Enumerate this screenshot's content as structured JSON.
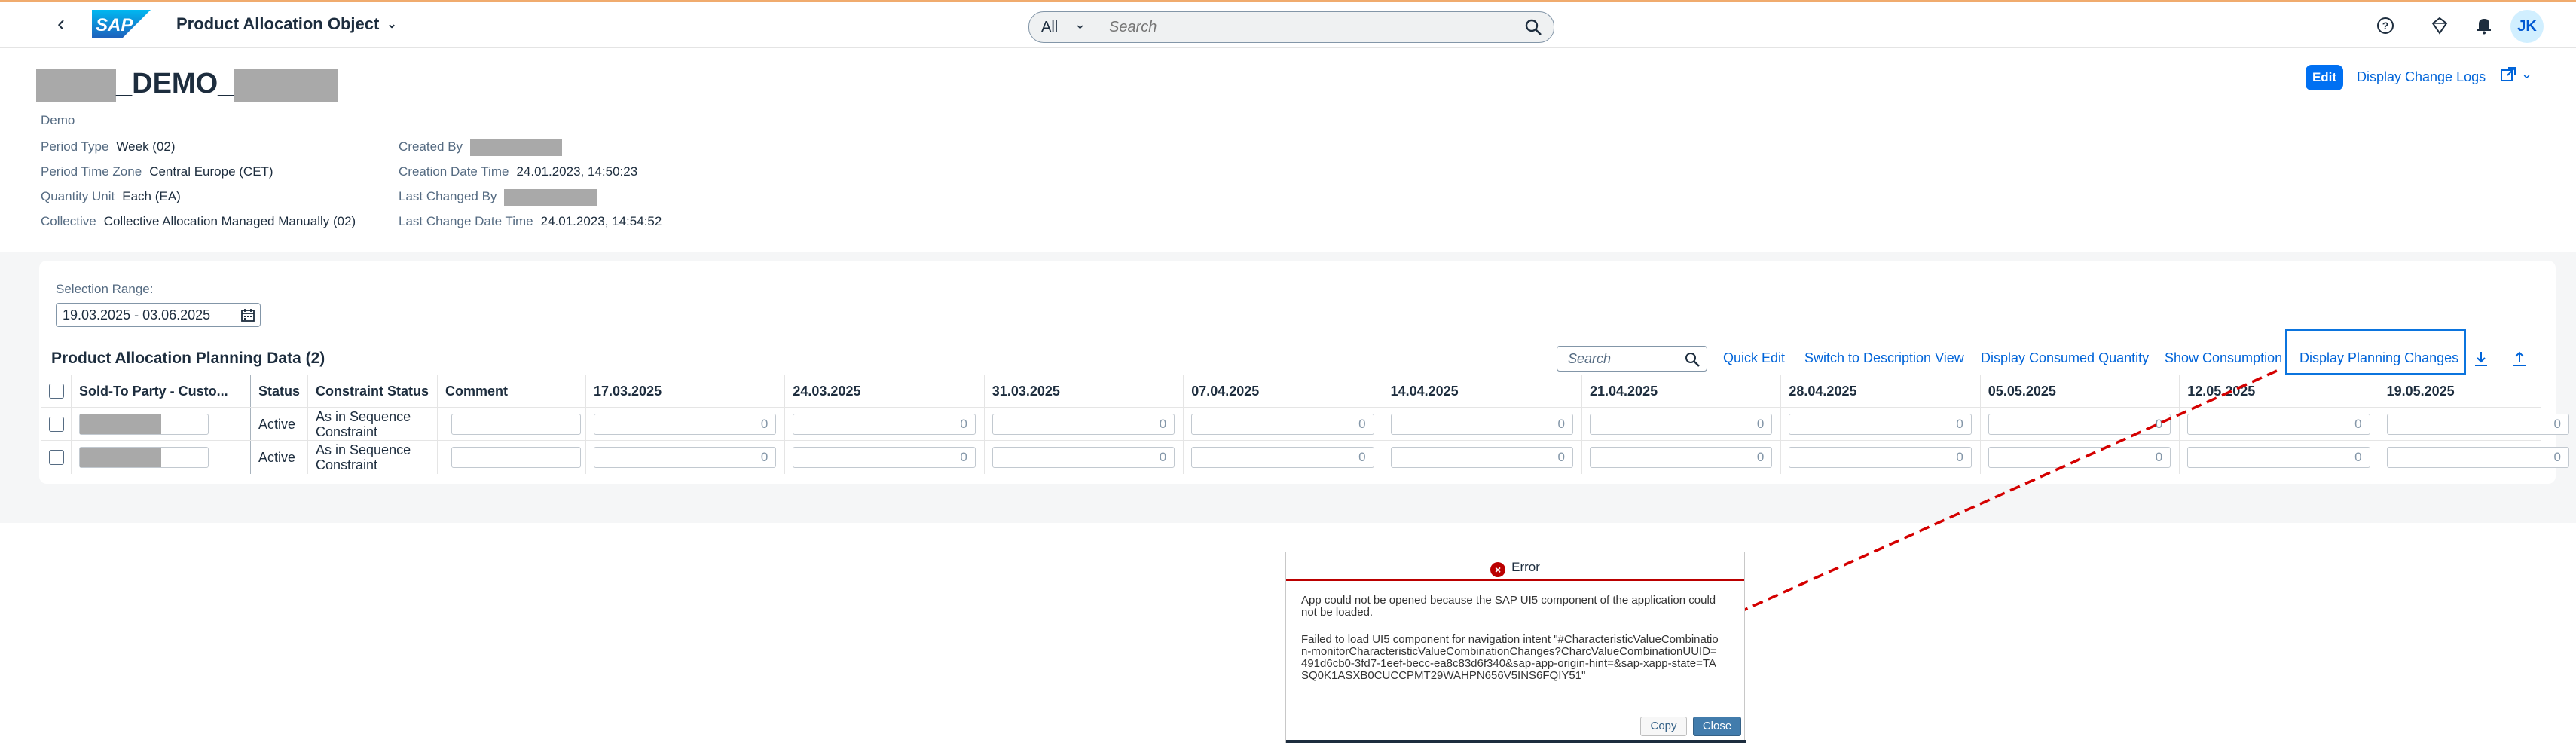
{
  "shell": {
    "app_title": "Product Allocation Object",
    "search_scope": "All",
    "search_placeholder": "Search",
    "avatar_initials": "JK"
  },
  "header": {
    "title_middle": "_DEMO_",
    "subtitle": "Demo",
    "left_attrs": [
      {
        "label": "Period Type",
        "value": "Week (02)"
      },
      {
        "label": "Period Time Zone",
        "value": "Central Europe (CET)"
      },
      {
        "label": "Quantity Unit",
        "value": "Each (EA)"
      },
      {
        "label": "Collective",
        "value": "Collective Allocation Managed Manually (02)"
      }
    ],
    "right_attrs": [
      {
        "label": "Created By",
        "value": ""
      },
      {
        "label": "Creation Date Time",
        "value": "24.01.2023, 14:50:23"
      },
      {
        "label": "Last Changed By",
        "value": ""
      },
      {
        "label": "Last Change Date Time",
        "value": "24.01.2023, 14:54:52"
      }
    ],
    "edit_label": "Edit",
    "change_logs_label": "Display Change Logs"
  },
  "selection": {
    "label": "Selection Range:",
    "value": "19.03.2025 - 03.06.2025"
  },
  "table": {
    "title": "Product Allocation Planning Data (2)",
    "search_placeholder": "Search",
    "toolbar": {
      "quick_edit": "Quick Edit",
      "switch_desc": "Switch to Description View",
      "consumed_qty": "Display Consumed Quantity",
      "show_consumption": "Show Consumption",
      "planning_changes": "Display Planning Changes"
    },
    "columns": {
      "sold_to": "Sold-To Party - Custo...",
      "status": "Status",
      "constraint": "Constraint Status",
      "comment": "Comment",
      "weeks": [
        "17.03.2025",
        "24.03.2025",
        "31.03.2025",
        "07.04.2025",
        "14.04.2025",
        "21.04.2025",
        "28.04.2025",
        "05.05.2025",
        "12.05.2025",
        "19.05.2025"
      ]
    },
    "rows": [
      {
        "status": "Active",
        "constraint_line1": "As in Sequence",
        "constraint_line2": "Constraint",
        "values": [
          "0",
          "0",
          "0",
          "0",
          "0",
          "0",
          "0",
          "0",
          "0",
          "0"
        ]
      },
      {
        "status": "Active",
        "constraint_line1": "As in Sequence",
        "constraint_line2": "Constraint",
        "values": [
          "0",
          "0",
          "0",
          "0",
          "0",
          "0",
          "0",
          "0",
          "0",
          "0"
        ]
      }
    ]
  },
  "dialog": {
    "title": "Error",
    "message1": "App could not be opened because the SAP UI5 component of the application could not be loaded.",
    "message2": "Failed to load UI5 component for navigation intent \"#CharacteristicValueCombination-monitorCharacteristicValueCombinationChanges?CharcValueCombinationUUID=491d6cb0-3fd7-1eef-becc-ea8c83d6f340&sap-app-origin-hint=&sap-xapp-state=TASQ0K1ASXB0CUCCPMT29WAHPN656V5INS6FQIY51\"",
    "copy_label": "Copy",
    "close_label": "Close"
  },
  "colors": {
    "accent": "#0070f2",
    "link": "#0064d9",
    "error": "#bb0000",
    "annotation": "#d40000"
  }
}
